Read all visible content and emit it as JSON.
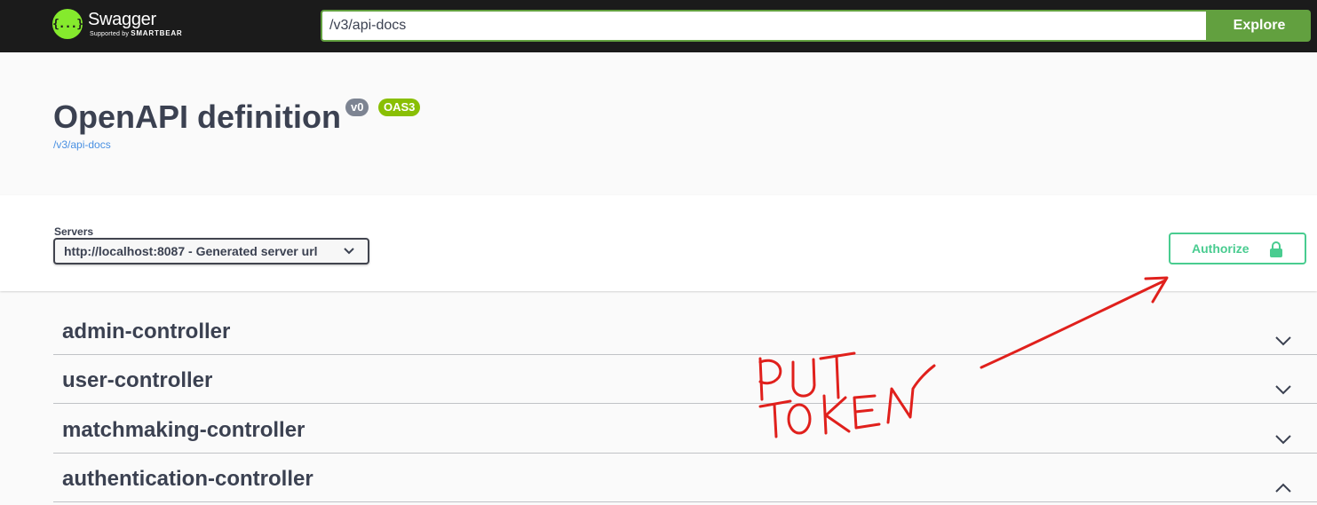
{
  "topbar": {
    "logo_name": "Swagger",
    "logo_sub_prefix": "Supported by",
    "logo_sub_brand": "SMARTBEAR",
    "logo_mark": "{...}",
    "url_value": "/v3/api-docs",
    "explore_label": "Explore"
  },
  "info": {
    "title": "OpenAPI definition",
    "version_badge": "v0",
    "oas_badge": "OAS3",
    "api_link": "/v3/api-docs"
  },
  "scheme": {
    "servers_label": "Servers",
    "selected_server": "http://localhost:8087 - Generated server url",
    "authorize_label": "Authorize"
  },
  "tags": [
    {
      "name": "admin-controller",
      "expanded": false
    },
    {
      "name": "user-controller",
      "expanded": false
    },
    {
      "name": "matchmaking-controller",
      "expanded": false
    },
    {
      "name": "authentication-controller",
      "expanded": true
    }
  ],
  "annotation": {
    "line1": "PUT",
    "line2": "TOKEN"
  },
  "colors": {
    "topbar_bg": "#1b1b1b",
    "accent_green": "#62a03f",
    "authorize_green": "#49cc90",
    "oas_badge": "#89bf04",
    "version_badge": "#7d8492",
    "link_blue": "#4990e2",
    "annotation_red": "#e0201c"
  }
}
